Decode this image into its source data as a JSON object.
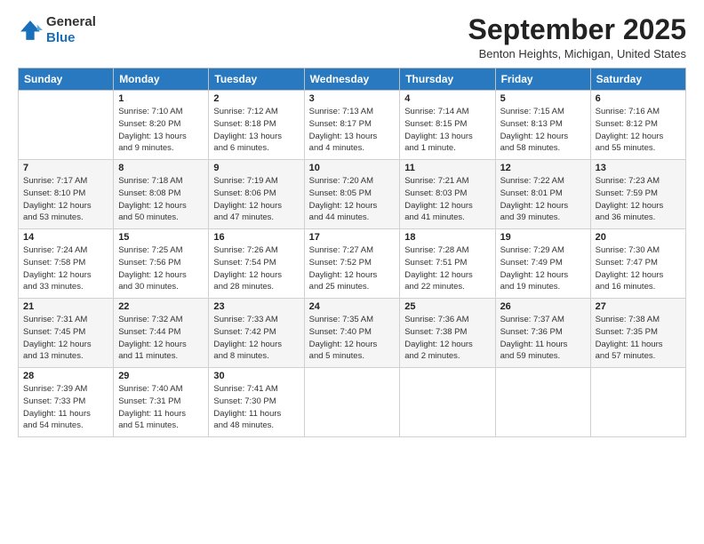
{
  "logo": {
    "line1": "General",
    "line2": "Blue"
  },
  "title": "September 2025",
  "subtitle": "Benton Heights, Michigan, United States",
  "days_of_week": [
    "Sunday",
    "Monday",
    "Tuesday",
    "Wednesday",
    "Thursday",
    "Friday",
    "Saturday"
  ],
  "weeks": [
    [
      {
        "day": "",
        "info": ""
      },
      {
        "day": "1",
        "info": "Sunrise: 7:10 AM\nSunset: 8:20 PM\nDaylight: 13 hours\nand 9 minutes."
      },
      {
        "day": "2",
        "info": "Sunrise: 7:12 AM\nSunset: 8:18 PM\nDaylight: 13 hours\nand 6 minutes."
      },
      {
        "day": "3",
        "info": "Sunrise: 7:13 AM\nSunset: 8:17 PM\nDaylight: 13 hours\nand 4 minutes."
      },
      {
        "day": "4",
        "info": "Sunrise: 7:14 AM\nSunset: 8:15 PM\nDaylight: 13 hours\nand 1 minute."
      },
      {
        "day": "5",
        "info": "Sunrise: 7:15 AM\nSunset: 8:13 PM\nDaylight: 12 hours\nand 58 minutes."
      },
      {
        "day": "6",
        "info": "Sunrise: 7:16 AM\nSunset: 8:12 PM\nDaylight: 12 hours\nand 55 minutes."
      }
    ],
    [
      {
        "day": "7",
        "info": "Sunrise: 7:17 AM\nSunset: 8:10 PM\nDaylight: 12 hours\nand 53 minutes."
      },
      {
        "day": "8",
        "info": "Sunrise: 7:18 AM\nSunset: 8:08 PM\nDaylight: 12 hours\nand 50 minutes."
      },
      {
        "day": "9",
        "info": "Sunrise: 7:19 AM\nSunset: 8:06 PM\nDaylight: 12 hours\nand 47 minutes."
      },
      {
        "day": "10",
        "info": "Sunrise: 7:20 AM\nSunset: 8:05 PM\nDaylight: 12 hours\nand 44 minutes."
      },
      {
        "day": "11",
        "info": "Sunrise: 7:21 AM\nSunset: 8:03 PM\nDaylight: 12 hours\nand 41 minutes."
      },
      {
        "day": "12",
        "info": "Sunrise: 7:22 AM\nSunset: 8:01 PM\nDaylight: 12 hours\nand 39 minutes."
      },
      {
        "day": "13",
        "info": "Sunrise: 7:23 AM\nSunset: 7:59 PM\nDaylight: 12 hours\nand 36 minutes."
      }
    ],
    [
      {
        "day": "14",
        "info": "Sunrise: 7:24 AM\nSunset: 7:58 PM\nDaylight: 12 hours\nand 33 minutes."
      },
      {
        "day": "15",
        "info": "Sunrise: 7:25 AM\nSunset: 7:56 PM\nDaylight: 12 hours\nand 30 minutes."
      },
      {
        "day": "16",
        "info": "Sunrise: 7:26 AM\nSunset: 7:54 PM\nDaylight: 12 hours\nand 28 minutes."
      },
      {
        "day": "17",
        "info": "Sunrise: 7:27 AM\nSunset: 7:52 PM\nDaylight: 12 hours\nand 25 minutes."
      },
      {
        "day": "18",
        "info": "Sunrise: 7:28 AM\nSunset: 7:51 PM\nDaylight: 12 hours\nand 22 minutes."
      },
      {
        "day": "19",
        "info": "Sunrise: 7:29 AM\nSunset: 7:49 PM\nDaylight: 12 hours\nand 19 minutes."
      },
      {
        "day": "20",
        "info": "Sunrise: 7:30 AM\nSunset: 7:47 PM\nDaylight: 12 hours\nand 16 minutes."
      }
    ],
    [
      {
        "day": "21",
        "info": "Sunrise: 7:31 AM\nSunset: 7:45 PM\nDaylight: 12 hours\nand 13 minutes."
      },
      {
        "day": "22",
        "info": "Sunrise: 7:32 AM\nSunset: 7:44 PM\nDaylight: 12 hours\nand 11 minutes."
      },
      {
        "day": "23",
        "info": "Sunrise: 7:33 AM\nSunset: 7:42 PM\nDaylight: 12 hours\nand 8 minutes."
      },
      {
        "day": "24",
        "info": "Sunrise: 7:35 AM\nSunset: 7:40 PM\nDaylight: 12 hours\nand 5 minutes."
      },
      {
        "day": "25",
        "info": "Sunrise: 7:36 AM\nSunset: 7:38 PM\nDaylight: 12 hours\nand 2 minutes."
      },
      {
        "day": "26",
        "info": "Sunrise: 7:37 AM\nSunset: 7:36 PM\nDaylight: 11 hours\nand 59 minutes."
      },
      {
        "day": "27",
        "info": "Sunrise: 7:38 AM\nSunset: 7:35 PM\nDaylight: 11 hours\nand 57 minutes."
      }
    ],
    [
      {
        "day": "28",
        "info": "Sunrise: 7:39 AM\nSunset: 7:33 PM\nDaylight: 11 hours\nand 54 minutes."
      },
      {
        "day": "29",
        "info": "Sunrise: 7:40 AM\nSunset: 7:31 PM\nDaylight: 11 hours\nand 51 minutes."
      },
      {
        "day": "30",
        "info": "Sunrise: 7:41 AM\nSunset: 7:30 PM\nDaylight: 11 hours\nand 48 minutes."
      },
      {
        "day": "",
        "info": ""
      },
      {
        "day": "",
        "info": ""
      },
      {
        "day": "",
        "info": ""
      },
      {
        "day": "",
        "info": ""
      }
    ]
  ]
}
